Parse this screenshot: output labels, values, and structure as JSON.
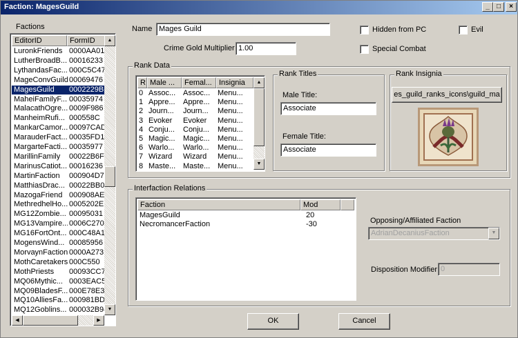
{
  "window": {
    "title": "Faction: MagesGuild"
  },
  "factions": {
    "label": "Factions",
    "col_editor": "EditorID",
    "col_form": "FormID",
    "selected_index": 5,
    "rows": [
      [
        "LuronkFriends",
        "0000AA01"
      ],
      [
        "LutherBroadB...",
        "00016233"
      ],
      [
        "LythandasFac...",
        "000C5C47"
      ],
      [
        "MageConvGuild",
        "00069476"
      ],
      [
        "MagesGuild",
        "0002229B"
      ],
      [
        "MaheiFamilyF...",
        "00035974"
      ],
      [
        "MalacathOgre...",
        "0009F986"
      ],
      [
        "ManheimRufi...",
        "000558C"
      ],
      [
        "MankarCamor...",
        "00097CAD"
      ],
      [
        "MarauderFact...",
        "00035FD1"
      ],
      [
        "MargarteFacti...",
        "00035977"
      ],
      [
        "MarillinFamily",
        "00022B6F"
      ],
      [
        "MarinusCatiot...",
        "00016236"
      ],
      [
        "MartinFaction",
        "000904D7"
      ],
      [
        "MatthiasDrac...",
        "00022BB0"
      ],
      [
        "MazogaFriend",
        "000908AE"
      ],
      [
        "MethredhelHo...",
        "0005202E"
      ],
      [
        "MG12Zombie...",
        "00095031"
      ],
      [
        "MG13Vampire...",
        "0006C270"
      ],
      [
        "MG16FortOnt...",
        "000C48A1"
      ],
      [
        "MogensWind...",
        "00085956"
      ],
      [
        "MorvaynFaction",
        "0000A273"
      ],
      [
        "MothCaretakers",
        "000C550"
      ],
      [
        "MothPriests",
        "00093CC7"
      ],
      [
        "MQ06Mythic...",
        "0003EAC5"
      ],
      [
        "MQ09BladesF...",
        "000E78E3"
      ],
      [
        "MQ10AlliesFa...",
        "000981BD"
      ],
      [
        "MQ12Goblins...",
        "000032B94"
      ]
    ]
  },
  "name": {
    "label": "Name",
    "value": "Mages Guild"
  },
  "crime": {
    "label": "Crime Gold Multiplier",
    "value": "1.00"
  },
  "flags": {
    "hidden": "Hidden from PC",
    "evil": "Evil",
    "special": "Special Combat"
  },
  "rank_data": {
    "label": "Rank Data",
    "cols": [
      "R",
      "Male ...",
      "Femal...",
      "Insignia"
    ],
    "rows": [
      [
        "0",
        "Assoc...",
        "Assoc...",
        "Menu..."
      ],
      [
        "1",
        "Appre...",
        "Appre...",
        "Menu..."
      ],
      [
        "2",
        "Journ...",
        "Journ...",
        "Menu..."
      ],
      [
        "3",
        "Evoker",
        "Evoker",
        "Menu..."
      ],
      [
        "4",
        "Conju...",
        "Conju...",
        "Menu..."
      ],
      [
        "5",
        "Magic...",
        "Magic...",
        "Menu..."
      ],
      [
        "6",
        "Warlo...",
        "Warlo...",
        "Menu..."
      ],
      [
        "7",
        "Wizard",
        "Wizard",
        "Menu..."
      ],
      [
        "8",
        "Maste...",
        "Maste...",
        "Menu..."
      ]
    ]
  },
  "rank_titles": {
    "label": "Rank Titles",
    "male_label": "Male Title:",
    "male_value": "Associate",
    "female_label": "Female Title:",
    "female_value": "Associate"
  },
  "rank_insignia": {
    "label": "Rank Insignia",
    "path": "es_guild_ranks_icons\\guild_ma"
  },
  "relations": {
    "label": "Interfaction Relations",
    "col_faction": "Faction",
    "col_mod": "Mod",
    "rows": [
      [
        "MagesGuild",
        "20"
      ],
      [
        "NecromancerFaction",
        "-30"
      ]
    ],
    "opposing_label": "Opposing/Affiliated Faction",
    "opposing_value": "AdrianDecaniusFaction",
    "disposition_label": "Disposition Modifier",
    "disposition_value": "0"
  },
  "buttons": {
    "ok": "OK",
    "cancel": "Cancel"
  }
}
